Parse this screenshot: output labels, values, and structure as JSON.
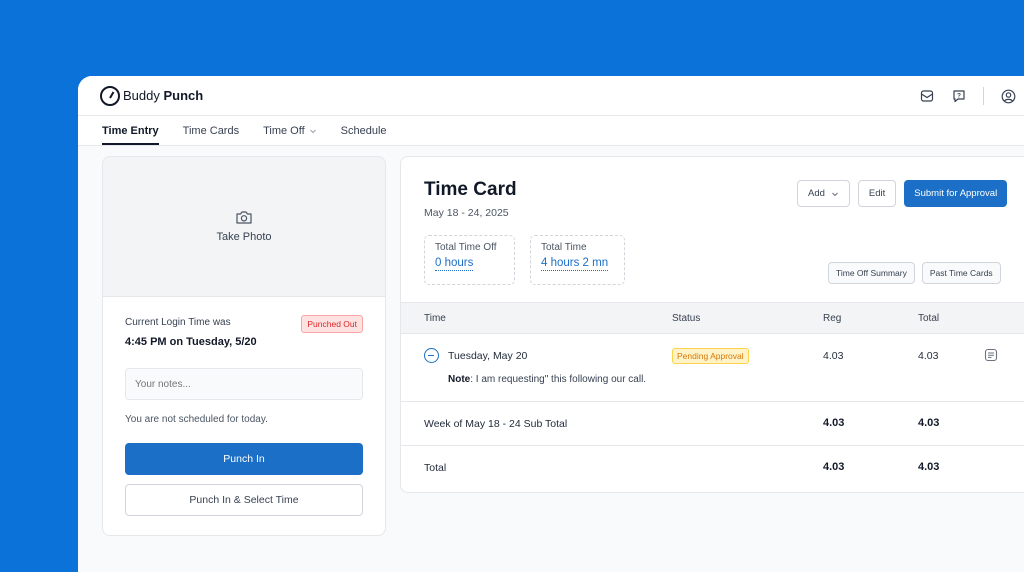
{
  "header": {
    "logo_word1": "Buddy",
    "logo_word2": "Punch"
  },
  "nav": {
    "items": [
      {
        "label": "Time Entry",
        "active": true
      },
      {
        "label": "Time Cards"
      },
      {
        "label": "Time Off"
      },
      {
        "label": "Schedule"
      }
    ]
  },
  "punch": {
    "photo_label": "Take Photo",
    "login_label": "Current Login Time was",
    "login_time": "4:45 PM on Tuesday, 5/20",
    "status_badge": "Punched Out",
    "notes_placeholder": "Your notes...",
    "schedule_text": "You are not scheduled for today.",
    "punch_in_label": "Punch In",
    "punch_in_select_label": "Punch In & Select Time"
  },
  "time_card": {
    "title": "Time Card",
    "date_range": "May 18 - 24, 2025",
    "add_label": "Add",
    "edit_label": "Edit",
    "submit_label": "Submit for Approval",
    "total_time_off_label": "Total Time Off",
    "total_time_off_value": "0 hours",
    "total_time_label": "Total Time",
    "total_time_value": "4 hours 2 mn",
    "time_off_summary_label": "Time Off Summary",
    "past_time_cards_label": "Past Time Cards",
    "columns": {
      "time": "Time",
      "status": "Status",
      "reg": "Reg",
      "total": "Total"
    },
    "day_row": {
      "date": "Tuesday, May 20",
      "status": "Pending Approval",
      "reg": "4.03",
      "total": "4.03",
      "note_label": "Note",
      "note_text": ": I am requesting\" this following our call."
    },
    "subtotal_row": {
      "label": "Week of May 18 - 24 Sub Total",
      "reg": "4.03",
      "total": "4.03"
    },
    "total_row": {
      "label": "Total",
      "reg": "4.03",
      "total": "4.03"
    }
  },
  "colors": {
    "background": "#0b72d9",
    "primary": "#1b6fc6",
    "danger": "#dc2626",
    "warning": "#d97706"
  }
}
